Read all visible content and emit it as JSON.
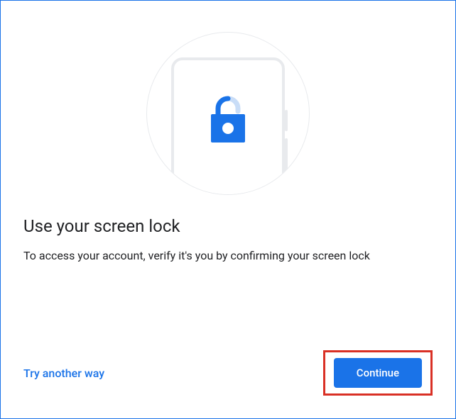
{
  "heading": "Use your screen lock",
  "subtext": "To access your account, verify it's you by confirming your screen lock",
  "actions": {
    "secondary_label": "Try another way",
    "primary_label": "Continue"
  },
  "icons": {
    "lock": "lock-icon"
  },
  "colors": {
    "primary": "#1a73e8",
    "highlight": "#d93025",
    "text": "#202124"
  }
}
